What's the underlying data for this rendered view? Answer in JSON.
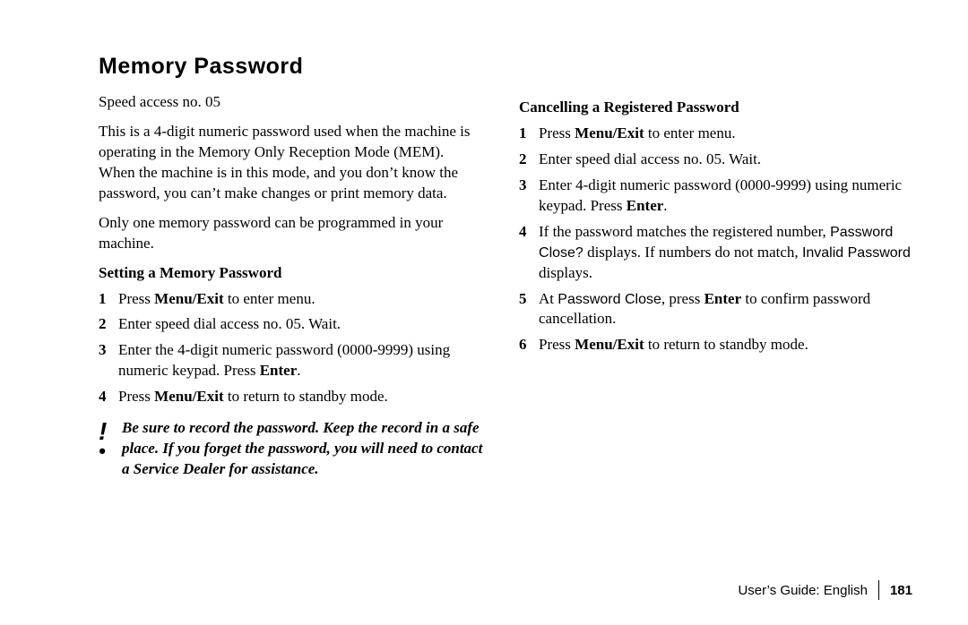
{
  "title": "Memory Password",
  "intro": {
    "speed_access": "Speed access no. 05",
    "p1": "This is a 4-digit numeric password used when the machine is operating in the Memory Only Reception Mode (MEM). When the machine is in this mode, and you don’t know the password, you can’t make changes or print memory data.",
    "p2": "Only one memory password can be programmed in your machine."
  },
  "setting": {
    "heading": "Setting a Memory Password",
    "steps": {
      "s1_a": "Press ",
      "s1_b": "Menu/Exit",
      "s1_c": " to enter menu.",
      "s2": "Enter speed dial access no. 05. Wait.",
      "s3_a": "Enter the 4-digit numeric password (0000-9999) using numeric keypad. Press ",
      "s3_b": "Enter",
      "s3_c": ".",
      "s4_a": "Press ",
      "s4_b": "Menu/Exit",
      "s4_c": " to return to standby mode."
    }
  },
  "note": "Be sure to record the password.  Keep the record in a safe place.  If you forget the password, you will need to contact a Service Dealer for assistance.",
  "cancel": {
    "heading": "Cancelling a Registered Password",
    "steps": {
      "s1_a": "Press ",
      "s1_b": "Menu/Exit",
      "s1_c": " to enter menu.",
      "s2": "Enter speed dial access no. 05.  Wait.",
      "s3_a": "Enter 4-digit numeric password (0000-9999) using numeric keypad.  Press ",
      "s3_b": "Enter",
      "s3_c": ".",
      "s4_a": "If the password matches the registered number, ",
      "s4_b": "Password Close?",
      "s4_c": " displays. If numbers do not match, ",
      "s4_d": "Invalid Password",
      "s4_e": " displays.",
      "s5_a": "At ",
      "s5_b": "Password Close",
      "s5_c": ", press ",
      "s5_d": "Enter",
      "s5_e": " to confirm password cancellation.",
      "s6_a": "Press ",
      "s6_b": "Menu/Exit",
      "s6_c": " to return to standby mode."
    }
  },
  "footer": {
    "label": "User’s Guide:  English",
    "page": "181"
  }
}
